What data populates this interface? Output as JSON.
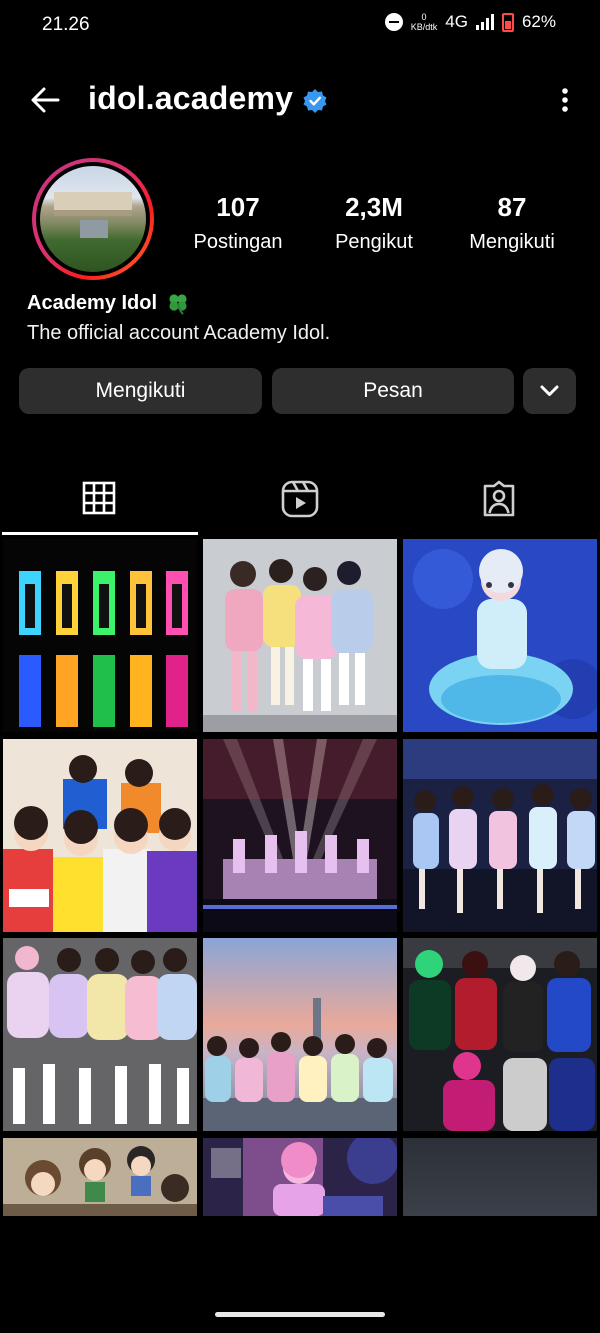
{
  "status": {
    "time": "21.26",
    "speed_value": "0",
    "speed_unit": "KB/dtk",
    "network": "4G",
    "battery": "62%"
  },
  "profile": {
    "handle": "idol.academy",
    "display_name": "Academy Idol",
    "bio": "The official account Academy Idol.",
    "stats": [
      {
        "value": "107",
        "label": "Postingan"
      },
      {
        "value": "2,3M",
        "label": "Pengikut"
      },
      {
        "value": "87",
        "label": "Mengikuti"
      }
    ]
  },
  "actions": {
    "following_label": "Mengikuti",
    "message_label": "Pesan"
  },
  "icons": {
    "back": "back-arrow-icon",
    "verified": "verified-badge-icon",
    "more": "more-vertical-icon",
    "clover": "four-leaf-clover-emoji",
    "grid": "grid-icon",
    "reels": "reels-icon",
    "tagged": "tagged-icon",
    "suggest": "chevron-down-icon"
  },
  "colors": {
    "verified": "#3897f0",
    "button_bg": "#2e2e2e",
    "background": "#000000"
  },
  "grid_posts": [
    {
      "name": "post-neon-silhouettes"
    },
    {
      "name": "post-pastel-dresses-group"
    },
    {
      "name": "post-blue-costume-performer"
    },
    {
      "name": "post-colorful-tshirts-group"
    },
    {
      "name": "post-stage-concert-lights"
    },
    {
      "name": "post-sparkly-skirts-stage"
    },
    {
      "name": "post-pastel-frills-group"
    },
    {
      "name": "post-rooftop-sunset"
    },
    {
      "name": "post-gothic-costumes"
    },
    {
      "name": "post-plush-dolls"
    },
    {
      "name": "post-pink-performer"
    },
    {
      "name": "post-dark-blurred"
    }
  ]
}
